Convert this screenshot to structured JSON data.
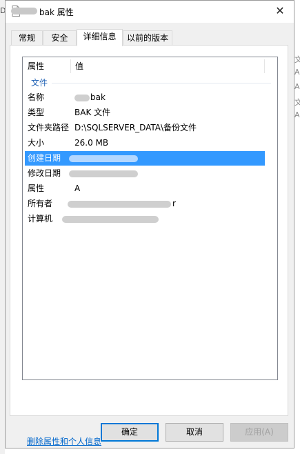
{
  "window": {
    "title": "bak 属性",
    "close_glyph": "✕"
  },
  "tabs": [
    "常规",
    "安全",
    "详细信息",
    "以前的版本"
  ],
  "columns": {
    "property": "属性",
    "value": "值"
  },
  "group": "文件",
  "rows": [
    {
      "key": "名称",
      "value": "bak"
    },
    {
      "key": "类型",
      "value": "BAK 文件"
    },
    {
      "key": "文件夹路径",
      "value": "D:\\SQLSERVER_DATA\\备份文件"
    },
    {
      "key": "大小",
      "value": "26.0 MB"
    },
    {
      "key": "创建日期",
      "value": ""
    },
    {
      "key": "修改日期",
      "value": ""
    },
    {
      "key": "属性",
      "value": "A"
    },
    {
      "key": "所有者",
      "value": "r"
    },
    {
      "key": "计算机",
      "value": ""
    }
  ],
  "link": "删除属性和个人信息",
  "buttons": {
    "ok": "确定",
    "cancel": "取消",
    "apply": "应用(A)"
  },
  "left_edge_text": "D",
  "right_edge_texts": [
    "文",
    "A",
    "A",
    "文",
    "A"
  ],
  "colors": {
    "selection": "#3399ff",
    "link": "#0066cc",
    "group": "#1e60b4",
    "default_button_border": "#0078d7"
  }
}
